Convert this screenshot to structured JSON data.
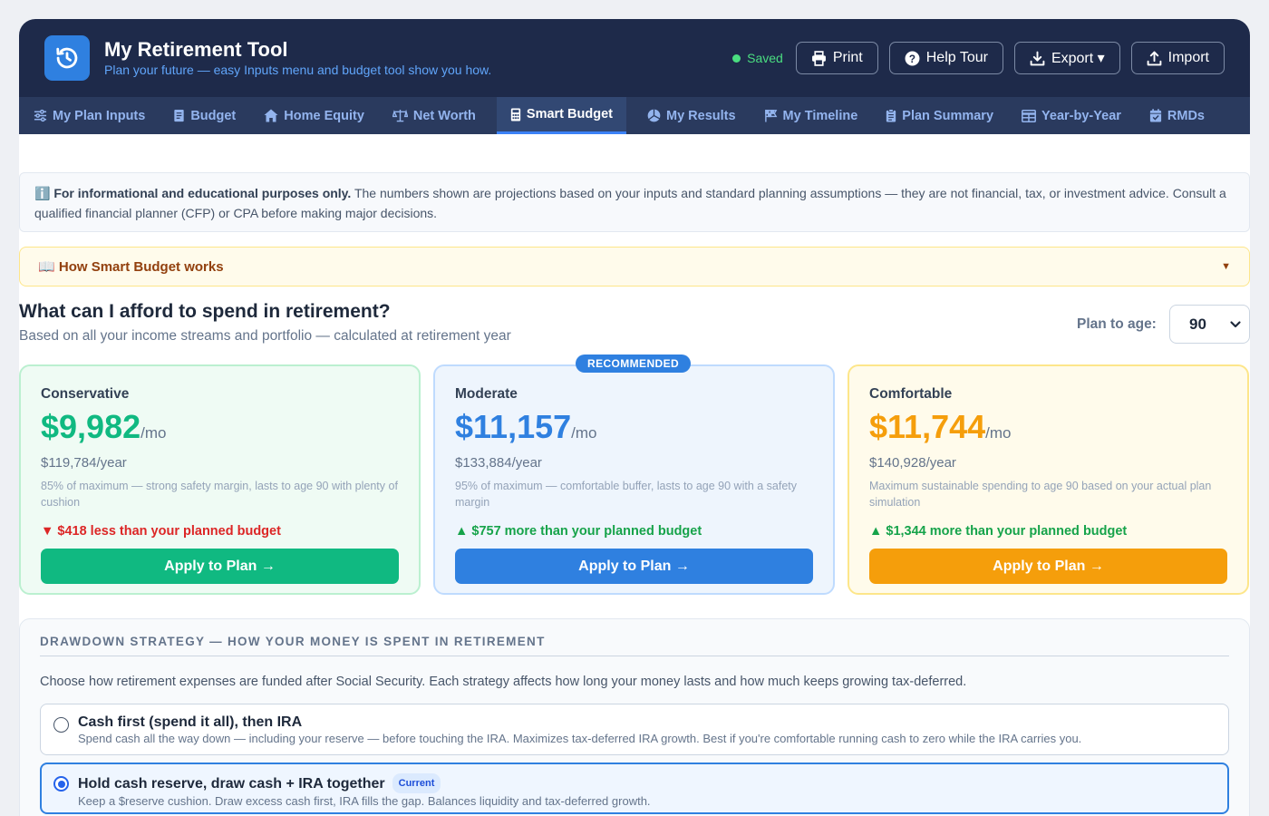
{
  "header": {
    "title": "My Retirement Tool",
    "subtitle": "Plan your future — easy Inputs menu and budget tool show you how.",
    "saved_label": "Saved",
    "buttons": {
      "print": "Print",
      "help_tour": "Help Tour",
      "export": "Export ▾",
      "import": "Import"
    }
  },
  "tabs": [
    {
      "label": "My Plan Inputs",
      "icon": "sliders-icon"
    },
    {
      "label": "Budget",
      "icon": "receipt-icon"
    },
    {
      "label": "Home Equity",
      "icon": "house-icon"
    },
    {
      "label": "Net Worth",
      "icon": "scale-icon"
    },
    {
      "label": "Smart Budget",
      "icon": "calculator-icon",
      "active": true
    },
    {
      "label": "My Results",
      "icon": "chart-pie-icon"
    },
    {
      "label": "My Timeline",
      "icon": "flag-icon"
    },
    {
      "label": "Plan Summary",
      "icon": "clipboard-icon"
    },
    {
      "label": "Year-by-Year",
      "icon": "table-icon"
    },
    {
      "label": "RMDs",
      "icon": "calendar-check-icon"
    }
  ],
  "disclaimer": {
    "icon": "ℹ️",
    "bold": "For informational and educational purposes only.",
    "text": " The numbers shown are projections based on your inputs and standard planning assumptions — they are not financial, tax, or investment advice. Consult a qualified financial planner (CFP) or CPA before making major decisions."
  },
  "how_it_works": {
    "icon": "📖",
    "label": "How Smart Budget works",
    "arrow": "▼"
  },
  "question": {
    "title": "What can I afford to spend in retirement?",
    "subtitle": "Based on all your income streams and portfolio — calculated at retirement year"
  },
  "plan_age": {
    "label": "Plan to age:",
    "value": "90"
  },
  "cards": [
    {
      "name": "Conservative",
      "amount": "$9,982",
      "per": "/mo",
      "yearly": "$119,784/year",
      "description": "85% of maximum — strong safety margin, lasts to age 90 with plenty of cushion",
      "diff": "▼ $418 less than your planned budget",
      "diff_type": "negative",
      "button": "Apply to Plan →",
      "color": "#10b981"
    },
    {
      "name": "Moderate",
      "badge": "RECOMMENDED",
      "amount": "$11,157",
      "per": "/mo",
      "yearly": "$133,884/year",
      "description": "95% of maximum — comfortable buffer, lasts to age 90 with a safety margin",
      "diff": "▲ $757 more than your planned budget",
      "diff_type": "positive",
      "button": "Apply to Plan →",
      "color": "#2f80e0"
    },
    {
      "name": "Comfortable",
      "amount": "$11,744",
      "per": "/mo",
      "yearly": "$140,928/year",
      "description": "Maximum sustainable spending to age 90 based on your actual plan simulation",
      "diff": "▲ $1,344 more than your planned budget",
      "diff_type": "positive",
      "button": "Apply to Plan →",
      "color": "#f59e0b"
    }
  ],
  "drawdown": {
    "title": "DRAWDOWN STRATEGY — HOW YOUR MONEY IS SPENT IN RETIREMENT",
    "description": "Choose how retirement expenses are funded after Social Security. Each strategy affects how long your money lasts and how much keeps growing tax-deferred.",
    "options": [
      {
        "title": "Cash first (spend it all), then IRA",
        "description": "Spend cash all the way down — including your reserve — before touching the IRA. Maximizes tax-deferred IRA growth. Best if you're comfortable running cash to zero while the IRA carries you.",
        "selected": false
      },
      {
        "title": "Hold cash reserve, draw cash + IRA together",
        "badge": "Current",
        "description": "Keep a $reserve cushion. Draw excess cash first, IRA fills the gap. Balances liquidity and tax-deferred growth.",
        "selected": true
      }
    ]
  }
}
